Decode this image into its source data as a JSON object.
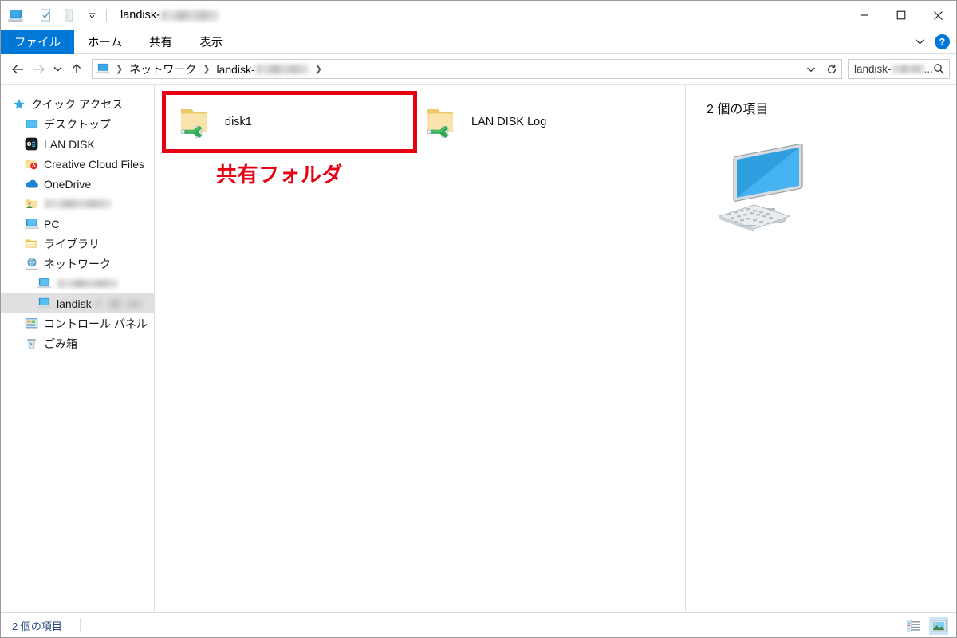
{
  "window": {
    "title_prefix": "landisk-",
    "title_suffix_masked": true,
    "app_icon": "network-computer-icon",
    "quick_access": [
      {
        "name": "properties-icon",
        "label": "プロパティ"
      },
      {
        "name": "new-folder-icon",
        "label": "新しいフォルダー"
      },
      {
        "name": "customize-qat-chevron-icon",
        "label": "クイック アクセス ツール バーのユーザー設定"
      }
    ],
    "controls": [
      {
        "name": "minimize-button",
        "glyph": "─"
      },
      {
        "name": "maximize-button",
        "glyph": "☐"
      },
      {
        "name": "close-button",
        "glyph": "✕"
      }
    ]
  },
  "ribbon": {
    "tabs": [
      {
        "id": "file",
        "label": "ファイル",
        "active": true
      },
      {
        "id": "home",
        "label": "ホーム",
        "active": false
      },
      {
        "id": "share",
        "label": "共有",
        "active": false
      },
      {
        "id": "view",
        "label": "表示",
        "active": false
      }
    ],
    "expand_icon": "chevron-down-icon",
    "help_label": "?"
  },
  "address_bar": {
    "back_label": "戻る",
    "forward_label": "進む",
    "recent_label": "最近表示した場所",
    "up_label": "上へ",
    "breadcrumb": [
      {
        "label": "ネットワーク",
        "masked": false
      },
      {
        "label": "landisk-",
        "masked": true
      }
    ],
    "dropdown_icon": "chevron-down-icon",
    "refresh_icon": "refresh-icon",
    "search": {
      "value_prefix": "landisk-",
      "value_suffix": "...",
      "placeholder": "検索",
      "icon": "search-icon"
    }
  },
  "sidebar": {
    "items": [
      {
        "label": "クイック アクセス",
        "icon": "star-icon",
        "level": 0,
        "selected": false,
        "masked": false
      },
      {
        "label": "デスクトップ",
        "icon": "desktop-icon",
        "level": 1,
        "selected": false,
        "masked": false
      },
      {
        "label": "LAN DISK",
        "icon": "lan-disk-icon",
        "level": 1,
        "selected": false,
        "masked": false
      },
      {
        "label": "Creative Cloud Files",
        "icon": "creative-cloud-folder-icon",
        "level": 1,
        "selected": false,
        "masked": false
      },
      {
        "label": "OneDrive",
        "icon": "onedrive-icon",
        "level": 1,
        "selected": false,
        "masked": false
      },
      {
        "label": "",
        "icon": "user-folder-icon",
        "level": 1,
        "selected": false,
        "masked": true
      },
      {
        "label": "PC",
        "icon": "pc-icon",
        "level": 1,
        "selected": false,
        "masked": false
      },
      {
        "label": "ライブラリ",
        "icon": "library-icon",
        "level": 1,
        "selected": false,
        "masked": false
      },
      {
        "label": "ネットワーク",
        "icon": "network-icon",
        "level": 1,
        "selected": false,
        "masked": false
      },
      {
        "label": "",
        "icon": "computer-icon",
        "level": 2,
        "selected": false,
        "masked": true
      },
      {
        "label": "landisk-",
        "icon": "computer-icon",
        "level": 2,
        "selected": true,
        "masked": true
      },
      {
        "label": "コントロール パネル",
        "icon": "control-panel-icon",
        "level": 1,
        "selected": false,
        "masked": false
      },
      {
        "label": "ごみ箱",
        "icon": "recycle-bin-icon",
        "level": 1,
        "selected": false,
        "masked": false
      }
    ]
  },
  "files": {
    "items": [
      {
        "label": "disk1",
        "icon": "shared-folder-icon",
        "selected": true
      },
      {
        "label": "LAN DISK Log",
        "icon": "shared-folder-icon",
        "selected": false
      }
    ]
  },
  "annotation": {
    "text": "共有フォルダ",
    "color": "#e60012",
    "target": "disk1"
  },
  "details_pane": {
    "title": "2 個の項目",
    "preview_icon": "computer-monitor-icon"
  },
  "status_bar": {
    "count_text": "2 個の項目",
    "views": [
      {
        "name": "details-view-button",
        "label": "詳細表示",
        "active": false
      },
      {
        "name": "large-icons-view-button",
        "label": "大アイコン表示",
        "active": true
      }
    ]
  }
}
